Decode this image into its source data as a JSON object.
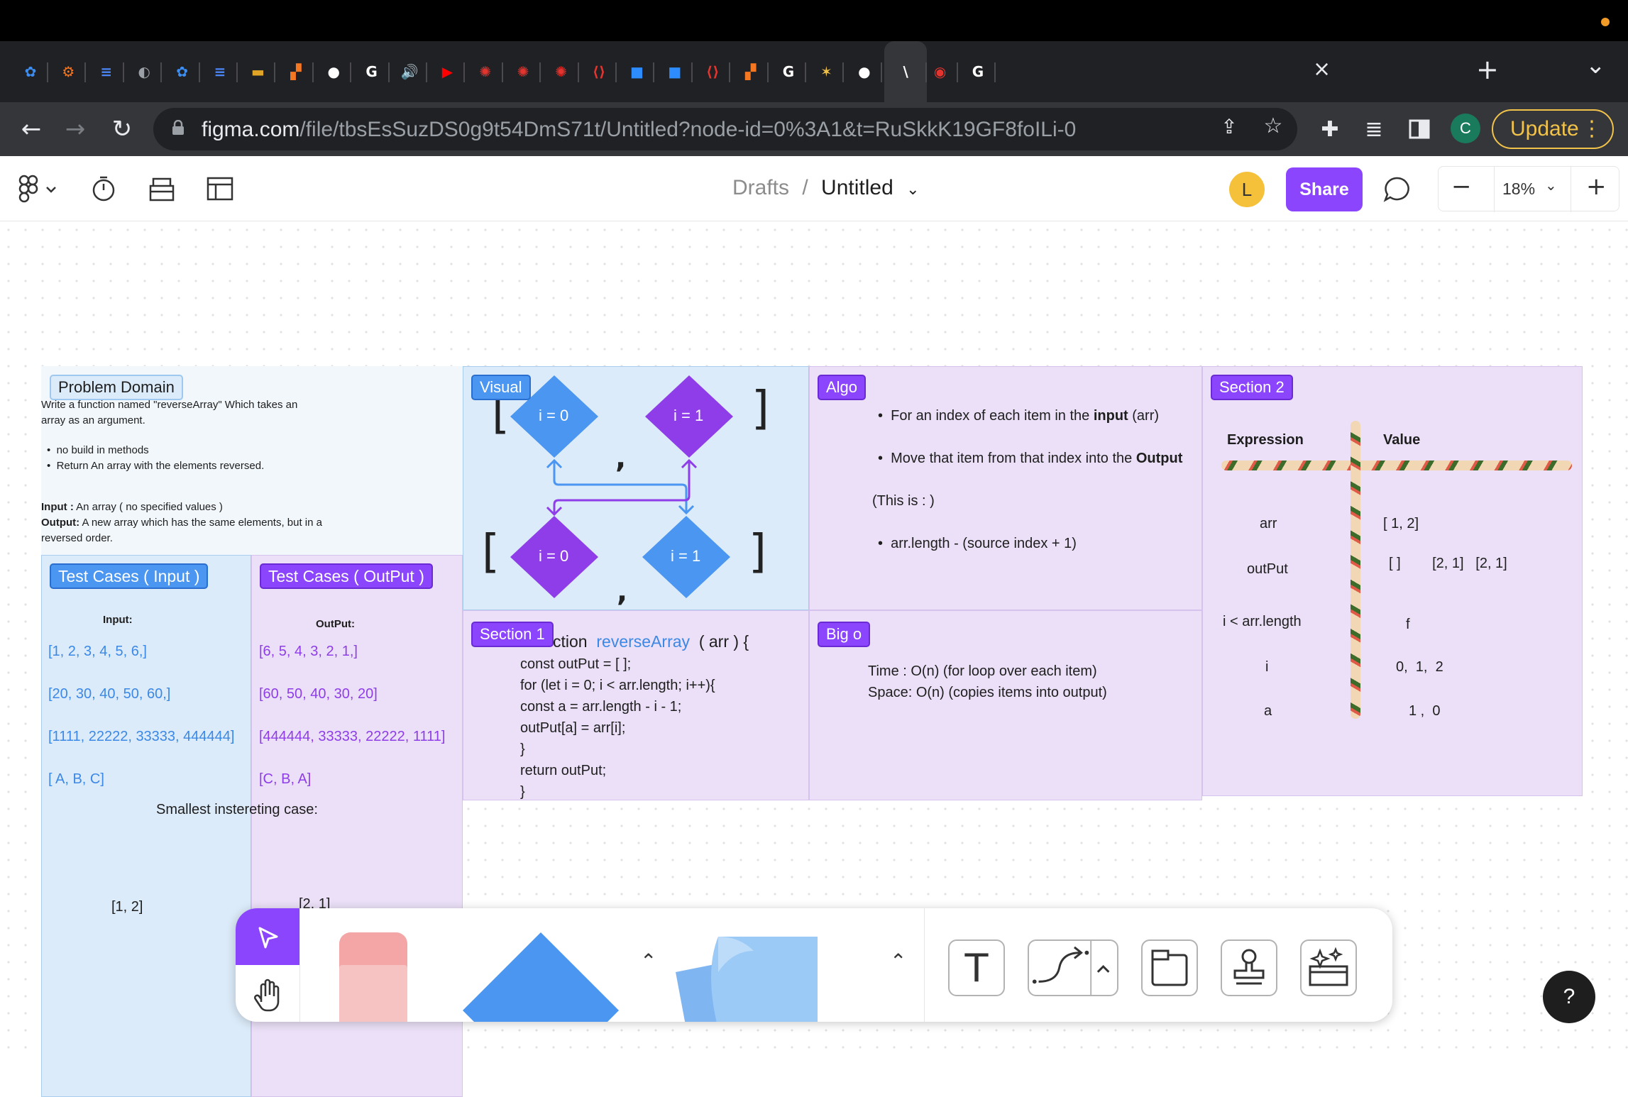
{
  "browser": {
    "tabs": [
      {
        "icon": "figma-app-icon",
        "color": "#3d8ef2",
        "glyph": "✿"
      },
      {
        "icon": "hubspot-icon",
        "color": "#f57722",
        "glyph": "⚙"
      },
      {
        "icon": "google-docs-icon",
        "color": "#4a86f7",
        "glyph": "≡"
      },
      {
        "icon": "globe-icon",
        "color": "#9aa0a6",
        "glyph": "◐"
      },
      {
        "icon": "figma-app-icon",
        "color": "#3d8ef2",
        "glyph": "✿"
      },
      {
        "icon": "google-docs-icon",
        "color": "#4a86f7",
        "glyph": "≡"
      },
      {
        "icon": "dark-image-icon",
        "color": "#e0a526",
        "glyph": "▬"
      },
      {
        "icon": "grid-app-icon",
        "color": "#f57722",
        "glyph": "▞"
      },
      {
        "icon": "github-icon",
        "color": "#ffffff",
        "glyph": "●"
      },
      {
        "icon": "google-icon",
        "color": "#ffffff",
        "glyph": "G"
      },
      {
        "icon": "audio-playing-icon",
        "color": "#ffffff",
        "glyph": "🔊"
      },
      {
        "icon": "youtube-icon",
        "color": "#ff0000",
        "glyph": "▶"
      },
      {
        "icon": "canvas-icon",
        "color": "#e3342f",
        "glyph": "✺"
      },
      {
        "icon": "canvas-icon",
        "color": "#e3342f",
        "glyph": "✺"
      },
      {
        "icon": "canvas-icon",
        "color": "#e3342f",
        "glyph": "✺"
      },
      {
        "icon": "code-shield-icon",
        "color": "#e3342f",
        "glyph": "⟨⟩"
      },
      {
        "icon": "zoom-icon",
        "color": "#2d8cff",
        "glyph": "■"
      },
      {
        "icon": "zoom-icon",
        "color": "#2d8cff",
        "glyph": "■"
      },
      {
        "icon": "code-shield-icon",
        "color": "#e3342f",
        "glyph": "⟨⟩"
      },
      {
        "icon": "grid-app-icon",
        "color": "#f57722",
        "glyph": "▞"
      },
      {
        "icon": "google-icon",
        "color": "#ffffff",
        "glyph": "G"
      },
      {
        "icon": "star-app-icon",
        "color": "#f2c34a",
        "glyph": "✶"
      },
      {
        "icon": "github-icon",
        "color": "#ffffff",
        "glyph": "●"
      },
      {
        "icon": "active-tab-icon",
        "color": "#ffffff",
        "glyph": "\\"
      },
      {
        "icon": "recording-icon",
        "color": "#e3342f",
        "glyph": "◉"
      },
      {
        "icon": "google-icon",
        "color": "#ffffff",
        "glyph": "G"
      }
    ],
    "url_host": "figma.com",
    "url_path": "/file/tbsEsSuzDS0g9t54DmS71t/Untitled?node-id=0%3A1&t=RuSkkK19GF8foILi-0",
    "profile_initial": "C",
    "update_label": "Update"
  },
  "figma": {
    "breadcrumb_parent": "Drafts",
    "breadcrumb_sep": "/",
    "file_name": "Untitled",
    "user_initial": "L",
    "share_label": "Share",
    "zoom_level": "18%"
  },
  "board": {
    "problem": {
      "tag": "Problem Domain",
      "line1": "Write a function named \"reverseArray\" Which takes an",
      "line2": "array as an argument.",
      "bullet1": "no build in methods",
      "bullet2": "Return An array with the elements reversed.",
      "input_label": "Input :",
      "input_text": " An array ( no specified values )",
      "output_label": "Output:",
      "output_text": " A new array which has the same elements, but in a",
      "output_text2": "reversed order."
    },
    "tc_input": {
      "tag": "Test Cases ( Input )",
      "header": "Input:",
      "cases": [
        "[1, 2, 3, 4, 5, 6,]",
        "[20, 30, 40, 50, 60,]",
        "[1111, 22222, 33333, 444444]",
        "[ A, B, C]"
      ],
      "smallest": "Smallest instereting case:",
      "smallest_value": "[1, 2]"
    },
    "tc_output": {
      "tag": "Test Cases ( OutPut )",
      "header": "OutPut:",
      "cases": [
        "[6, 5, 4, 3, 2, 1,]",
        "[60, 50, 40, 30, 20]",
        "[444444, 33333, 22222, 1111]",
        "[C, B, A]"
      ],
      "smallest_value": "[2, 1]"
    },
    "visual": {
      "tag": "Visual",
      "top_left": "i = 0",
      "top_right": "i = 1",
      "bottom_left": "i = 0",
      "bottom_right": "i = 1",
      "bracket_open": "[",
      "bracket_close": "]",
      "comma": ","
    },
    "algo": {
      "tag": "Algo",
      "b1_pre": "For an index of each item in the ",
      "b1_bold": "input",
      "b1_post": " (arr)",
      "b2_pre": "Move that item from that index into the ",
      "b2_bold": "Output",
      "note": "(This is : )",
      "b3": "arr.length - (source index + 1)"
    },
    "section2": {
      "tag": "Section 2",
      "col_expr": "Expression",
      "col_value": "Value",
      "rows": [
        {
          "expr": "arr",
          "value": "[ 1, 2]"
        },
        {
          "expr": "outPut",
          "value": "[ ]        [2, 1]   [2, 1]"
        },
        {
          "expr": "i < arr.length",
          "value": "f"
        },
        {
          "expr": "i",
          "value": "0,  1,  2"
        },
        {
          "expr": "a",
          "value": "1 ,  0"
        }
      ]
    },
    "section1": {
      "tag": "Section 1",
      "fn_keyword": "ction",
      "fn_name": "reverseArray",
      "fn_params": "( arr ) {",
      "code": [
        "const outPut = [ ];",
        "for (let i = 0; i < arr.length; i++){",
        "const a = arr.length - i - 1;",
        "outPut[a] = arr[i];",
        "}",
        "return outPut;",
        "}"
      ]
    },
    "bigo": {
      "tag": "Big o",
      "time": "Time : O(n) (for loop over each item)",
      "space": "Space: O(n) (copies items into output)"
    }
  },
  "colors": {
    "figma_purple": "#8b45fc",
    "diamond_blue": "#4a96f0",
    "diamond_purple": "#8e3de8",
    "panel_blue": "#dcebf9",
    "panel_purple": "#ebe0f7",
    "tag_blue": "#4a96f0",
    "tag_purple": "#8b45fc"
  }
}
